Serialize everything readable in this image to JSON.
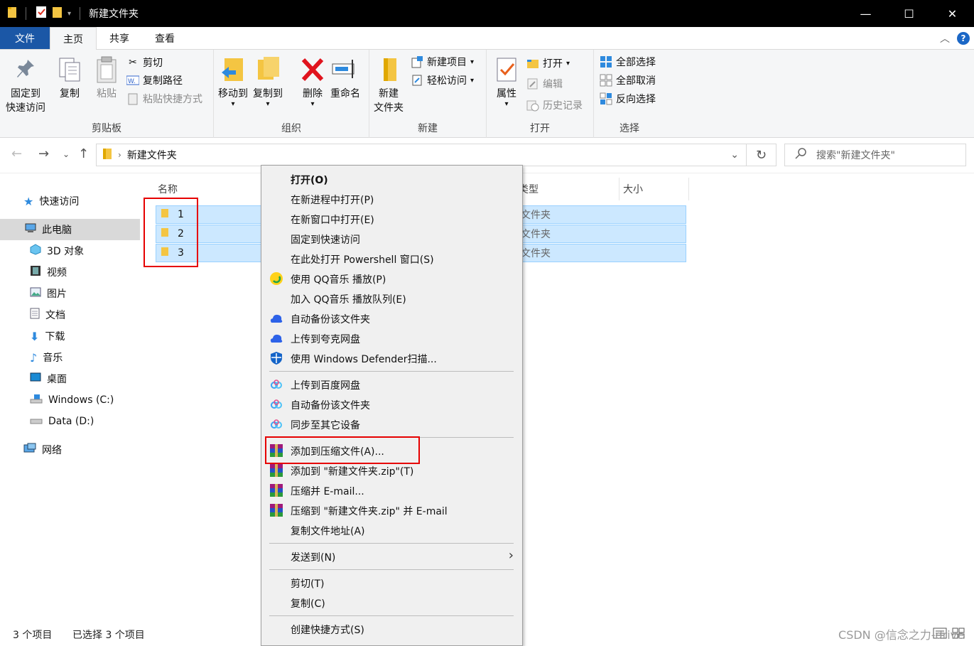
{
  "window": {
    "title": "新建文件夹",
    "controls": {
      "minimize": "—",
      "maximize": "☐",
      "close": "✕"
    }
  },
  "tabs": [
    "文件",
    "主页",
    "共享",
    "查看"
  ],
  "ribbon": {
    "clipboard": {
      "label": "剪贴板",
      "pin": [
        "固定到",
        "快速访问"
      ],
      "copy": "复制",
      "paste": "粘贴",
      "cut": "剪切",
      "copy_path": "复制路径",
      "paste_shortcut": "粘贴快捷方式"
    },
    "organize": {
      "label": "组织",
      "move_to": "移动到",
      "copy_to": "复制到",
      "delete": "删除",
      "rename": "重命名"
    },
    "new": {
      "label": "新建",
      "new_folder": [
        "新建",
        "文件夹"
      ],
      "new_item": "新建项目",
      "easy_access": "轻松访问"
    },
    "open": {
      "label": "打开",
      "properties": "属性",
      "open": "打开",
      "edit": "编辑",
      "history": "历史记录"
    },
    "select": {
      "label": "选择",
      "select_all": "全部选择",
      "select_none": "全部取消",
      "invert": "反向选择"
    }
  },
  "address": {
    "path": "新建文件夹",
    "search_placeholder": "搜索\"新建文件夹\""
  },
  "nav": [
    {
      "label": "快速访问",
      "icon": "star-icon"
    },
    {
      "label": "此电脑",
      "icon": "pc-icon",
      "selected": true
    },
    {
      "label": "3D 对象",
      "icon": "cube-icon"
    },
    {
      "label": "视频",
      "icon": "video-icon"
    },
    {
      "label": "图片",
      "icon": "picture-icon"
    },
    {
      "label": "文档",
      "icon": "document-icon"
    },
    {
      "label": "下载",
      "icon": "download-icon"
    },
    {
      "label": "音乐",
      "icon": "music-icon"
    },
    {
      "label": "桌面",
      "icon": "desktop-icon"
    },
    {
      "label": "Windows (C:)",
      "icon": "drive-icon"
    },
    {
      "label": "Data (D:)",
      "icon": "drive-icon"
    },
    {
      "label": "网络",
      "icon": "network-icon"
    }
  ],
  "columns": {
    "name": "名称",
    "type": "类型",
    "size": "大小"
  },
  "files": [
    {
      "name": "1",
      "type": "文件夹"
    },
    {
      "name": "2",
      "type": "文件夹"
    },
    {
      "name": "3",
      "type": "文件夹"
    }
  ],
  "status": {
    "count": "3 个项目",
    "selected": "已选择 3 个项目"
  },
  "context_menu": {
    "group1": [
      {
        "label": "打开(O)",
        "bold": true
      },
      {
        "label": "在新进程中打开(P)"
      },
      {
        "label": "在新窗口中打开(E)"
      },
      {
        "label": "固定到快速访问"
      },
      {
        "label": "在此处打开 Powershell 窗口(S)"
      },
      {
        "label": "使用 QQ音乐 播放(P)",
        "icon": "qqmusic-icon"
      },
      {
        "label": "加入 QQ音乐 播放队列(E)"
      },
      {
        "label": "自动备份该文件夹",
        "icon": "quark-cloud-icon"
      },
      {
        "label": "上传到夸克网盘",
        "icon": "quark-cloud-icon"
      },
      {
        "label": "使用 Windows Defender扫描...",
        "icon": "defender-icon"
      }
    ],
    "group2": [
      {
        "label": "上传到百度网盘",
        "icon": "baidu-icon"
      },
      {
        "label": "自动备份该文件夹",
        "icon": "baidu-icon"
      },
      {
        "label": "同步至其它设备",
        "icon": "baidu-icon"
      }
    ],
    "group3": [
      {
        "label": "添加到压缩文件(A)...",
        "icon": "winrar-icon"
      },
      {
        "label": "添加到 \"新建文件夹.zip\"(T)",
        "icon": "winrar-icon"
      },
      {
        "label": "压缩并 E-mail...",
        "icon": "winrar-icon"
      },
      {
        "label": "压缩到 \"新建文件夹.zip\" 并 E-mail",
        "icon": "winrar-icon"
      },
      {
        "label": "复制文件地址(A)"
      }
    ],
    "group4": [
      {
        "label": "发送到(N)"
      }
    ],
    "group5": [
      {
        "label": "剪切(T)"
      },
      {
        "label": "复制(C)"
      }
    ],
    "group6": [
      {
        "label": "创建快捷方式(S)"
      }
    ]
  },
  "watermark": "CSDN @信念之力-drive"
}
